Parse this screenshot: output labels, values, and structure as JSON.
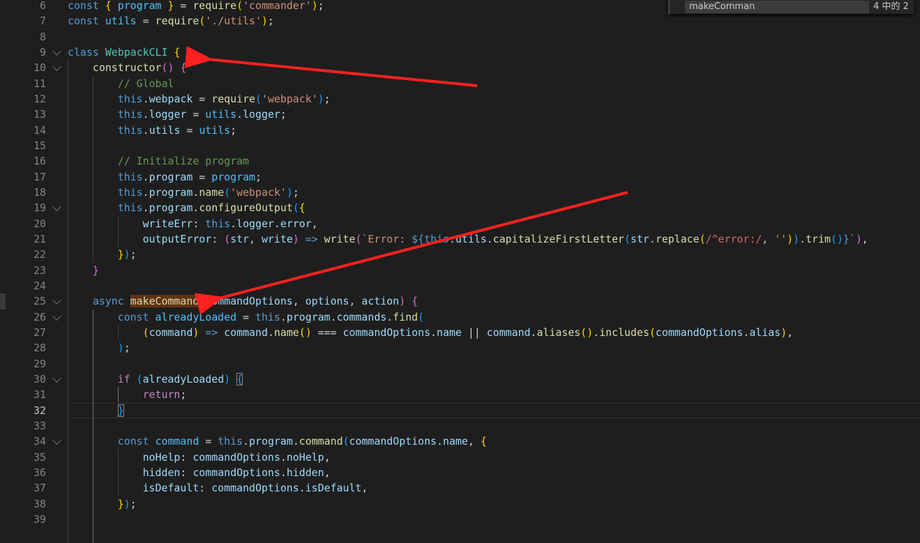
{
  "find_widget": {
    "query": "makeComman",
    "result_count": "4 中的 2"
  },
  "current_line": 32,
  "annotation_color": "#ff2020",
  "lines": [
    {
      "n": 6,
      "t": [
        [
          "k",
          "const "
        ],
        [
          "b1",
          "{"
        ],
        [
          "cv",
          " program "
        ],
        [
          "b1",
          "}"
        ],
        [
          "p",
          " = "
        ],
        [
          "f",
          "require"
        ],
        [
          "b1",
          "("
        ],
        [
          "s",
          "'commander'"
        ],
        [
          "b1",
          ")"
        ],
        [
          "p",
          ";"
        ]
      ]
    },
    {
      "n": 7,
      "t": [
        [
          "k",
          "const "
        ],
        [
          "cv",
          "utils"
        ],
        [
          "p",
          " = "
        ],
        [
          "f",
          "require"
        ],
        [
          "b1",
          "("
        ],
        [
          "s",
          "'./utils'"
        ],
        [
          "b1",
          ")"
        ],
        [
          "p",
          ";"
        ]
      ]
    },
    {
      "n": 8,
      "t": []
    },
    {
      "n": 9,
      "fold": true,
      "t": [
        [
          "k",
          "class "
        ],
        [
          "t",
          "WebpackCLI "
        ],
        [
          "b1",
          "{"
        ]
      ]
    },
    {
      "n": 10,
      "fold": true,
      "t": [
        [
          "p",
          "    "
        ],
        [
          "f",
          "constructor"
        ],
        [
          "b2",
          "()"
        ],
        [
          "p",
          " "
        ],
        [
          "b2",
          "{"
        ]
      ]
    },
    {
      "n": 11,
      "t": [
        [
          "p",
          "        "
        ],
        [
          "cm",
          "// Global"
        ]
      ]
    },
    {
      "n": 12,
      "t": [
        [
          "p",
          "        "
        ],
        [
          "k",
          "this"
        ],
        [
          "p",
          "."
        ],
        [
          "v",
          "webpack"
        ],
        [
          "p",
          " = "
        ],
        [
          "f",
          "require"
        ],
        [
          "b3",
          "("
        ],
        [
          "s",
          "'webpack'"
        ],
        [
          "b3",
          ")"
        ],
        [
          "p",
          ";"
        ]
      ]
    },
    {
      "n": 13,
      "t": [
        [
          "p",
          "        "
        ],
        [
          "k",
          "this"
        ],
        [
          "p",
          "."
        ],
        [
          "v",
          "logger"
        ],
        [
          "p",
          " = "
        ],
        [
          "cv",
          "utils"
        ],
        [
          "p",
          "."
        ],
        [
          "v",
          "logger"
        ],
        [
          "p",
          ";"
        ]
      ]
    },
    {
      "n": 14,
      "t": [
        [
          "p",
          "        "
        ],
        [
          "k",
          "this"
        ],
        [
          "p",
          "."
        ],
        [
          "v",
          "utils"
        ],
        [
          "p",
          " = "
        ],
        [
          "cv",
          "utils"
        ],
        [
          "p",
          ";"
        ]
      ]
    },
    {
      "n": 15,
      "t": []
    },
    {
      "n": 16,
      "t": [
        [
          "p",
          "        "
        ],
        [
          "cm",
          "// Initialize program"
        ]
      ]
    },
    {
      "n": 17,
      "t": [
        [
          "p",
          "        "
        ],
        [
          "k",
          "this"
        ],
        [
          "p",
          "."
        ],
        [
          "v",
          "program"
        ],
        [
          "p",
          " = "
        ],
        [
          "cv",
          "program"
        ],
        [
          "p",
          ";"
        ]
      ]
    },
    {
      "n": 18,
      "t": [
        [
          "p",
          "        "
        ],
        [
          "k",
          "this"
        ],
        [
          "p",
          "."
        ],
        [
          "v",
          "program"
        ],
        [
          "p",
          "."
        ],
        [
          "f",
          "name"
        ],
        [
          "b3",
          "("
        ],
        [
          "s",
          "'webpack'"
        ],
        [
          "b3",
          ")"
        ],
        [
          "p",
          ";"
        ]
      ]
    },
    {
      "n": 19,
      "fold": true,
      "t": [
        [
          "p",
          "        "
        ],
        [
          "k",
          "this"
        ],
        [
          "p",
          "."
        ],
        [
          "v",
          "program"
        ],
        [
          "p",
          "."
        ],
        [
          "f",
          "configureOutput"
        ],
        [
          "b3",
          "("
        ],
        [
          "b1",
          "{"
        ]
      ]
    },
    {
      "n": 20,
      "t": [
        [
          "p",
          "            "
        ],
        [
          "v",
          "writeErr"
        ],
        [
          "p",
          ": "
        ],
        [
          "k",
          "this"
        ],
        [
          "p",
          "."
        ],
        [
          "v",
          "logger"
        ],
        [
          "p",
          "."
        ],
        [
          "v",
          "error"
        ],
        [
          "p",
          ","
        ]
      ]
    },
    {
      "n": 21,
      "t": [
        [
          "p",
          "            "
        ],
        [
          "v",
          "outputError"
        ],
        [
          "p",
          ": "
        ],
        [
          "b2",
          "("
        ],
        [
          "v",
          "str"
        ],
        [
          "p",
          ", "
        ],
        [
          "v",
          "write"
        ],
        [
          "b2",
          ")"
        ],
        [
          "p",
          " "
        ],
        [
          "k",
          "=>"
        ],
        [
          "p",
          " "
        ],
        [
          "f",
          "write"
        ],
        [
          "b2",
          "("
        ],
        [
          "s",
          "`Error: "
        ],
        [
          "k",
          "${"
        ],
        [
          "k",
          "this"
        ],
        [
          "p",
          "."
        ],
        [
          "v",
          "utils"
        ],
        [
          "p",
          "."
        ],
        [
          "f",
          "capitalizeFirstLetter"
        ],
        [
          "b3",
          "("
        ],
        [
          "v",
          "str"
        ],
        [
          "p",
          "."
        ],
        [
          "f",
          "replace"
        ],
        [
          "b1",
          "("
        ],
        [
          "r",
          "/^error:/"
        ],
        [
          "p",
          ", "
        ],
        [
          "s",
          "''"
        ],
        [
          "b1",
          ")"
        ],
        [
          "b3",
          ")"
        ],
        [
          "p",
          "."
        ],
        [
          "f",
          "trim"
        ],
        [
          "b3",
          "()"
        ],
        [
          "k",
          "}"
        ],
        [
          "s",
          "`"
        ],
        [
          "b2",
          ")"
        ],
        [
          "p",
          ","
        ]
      ]
    },
    {
      "n": 22,
      "t": [
        [
          "p",
          "        "
        ],
        [
          "b1",
          "}"
        ],
        [
          "b3",
          ")"
        ],
        [
          "p",
          ";"
        ]
      ]
    },
    {
      "n": 23,
      "t": [
        [
          "p",
          "    "
        ],
        [
          "b2",
          "}"
        ]
      ]
    },
    {
      "n": 24,
      "t": []
    },
    {
      "n": 25,
      "fold": true,
      "t": [
        [
          "p",
          "    "
        ],
        [
          "k",
          "async "
        ],
        [
          "f hl",
          "makeCommand"
        ],
        [
          "b2",
          "("
        ],
        [
          "v",
          "commandOptions"
        ],
        [
          "p",
          ", "
        ],
        [
          "v",
          "options"
        ],
        [
          "p",
          ", "
        ],
        [
          "v",
          "action"
        ],
        [
          "b2",
          ")"
        ],
        [
          "p",
          " "
        ],
        [
          "b2",
          "{"
        ]
      ]
    },
    {
      "n": 26,
      "fold": true,
      "t": [
        [
          "p",
          "        "
        ],
        [
          "k",
          "const "
        ],
        [
          "cv",
          "alreadyLoaded"
        ],
        [
          "p",
          " = "
        ],
        [
          "k",
          "this"
        ],
        [
          "p",
          "."
        ],
        [
          "v",
          "program"
        ],
        [
          "p",
          "."
        ],
        [
          "v",
          "commands"
        ],
        [
          "p",
          "."
        ],
        [
          "f",
          "find"
        ],
        [
          "b3",
          "("
        ]
      ]
    },
    {
      "n": 27,
      "t": [
        [
          "p",
          "            "
        ],
        [
          "b1",
          "("
        ],
        [
          "v",
          "command"
        ],
        [
          "b1",
          ")"
        ],
        [
          "p",
          " "
        ],
        [
          "k",
          "=>"
        ],
        [
          "p",
          " "
        ],
        [
          "v",
          "command"
        ],
        [
          "p",
          "."
        ],
        [
          "f",
          "name"
        ],
        [
          "b1",
          "()"
        ],
        [
          "p",
          " === "
        ],
        [
          "v",
          "commandOptions"
        ],
        [
          "p",
          "."
        ],
        [
          "v",
          "name"
        ],
        [
          "p",
          " || "
        ],
        [
          "v",
          "command"
        ],
        [
          "p",
          "."
        ],
        [
          "f",
          "aliases"
        ],
        [
          "b1",
          "()"
        ],
        [
          "p",
          "."
        ],
        [
          "f",
          "includes"
        ],
        [
          "b1",
          "("
        ],
        [
          "v",
          "commandOptions"
        ],
        [
          "p",
          "."
        ],
        [
          "v",
          "alias"
        ],
        [
          "b1",
          ")"
        ],
        [
          "p",
          ","
        ]
      ]
    },
    {
      "n": 28,
      "t": [
        [
          "p",
          "        "
        ],
        [
          "b3",
          ")"
        ],
        [
          "p",
          ";"
        ]
      ]
    },
    {
      "n": 29,
      "t": []
    },
    {
      "n": 30,
      "fold": true,
      "t": [
        [
          "p",
          "        "
        ],
        [
          "c",
          "if"
        ],
        [
          "p",
          " "
        ],
        [
          "b3",
          "("
        ],
        [
          "v",
          "alreadyLoaded"
        ],
        [
          "b3",
          ")"
        ],
        [
          "p",
          " "
        ],
        [
          "b3 box",
          "{"
        ]
      ]
    },
    {
      "n": 31,
      "t": [
        [
          "p",
          "            "
        ],
        [
          "c",
          "return"
        ],
        [
          "p",
          ";"
        ]
      ]
    },
    {
      "n": 32,
      "t": [
        [
          "p",
          "        "
        ],
        [
          "b3 box",
          "}"
        ]
      ]
    },
    {
      "n": 33,
      "t": []
    },
    {
      "n": 34,
      "fold": true,
      "t": [
        [
          "p",
          "        "
        ],
        [
          "k",
          "const "
        ],
        [
          "cv",
          "command"
        ],
        [
          "p",
          " = "
        ],
        [
          "k",
          "this"
        ],
        [
          "p",
          "."
        ],
        [
          "v",
          "program"
        ],
        [
          "p",
          "."
        ],
        [
          "f",
          "command"
        ],
        [
          "b3",
          "("
        ],
        [
          "v",
          "commandOptions"
        ],
        [
          "p",
          "."
        ],
        [
          "v",
          "name"
        ],
        [
          "p",
          ", "
        ],
        [
          "b1",
          "{"
        ]
      ]
    },
    {
      "n": 35,
      "t": [
        [
          "p",
          "            "
        ],
        [
          "v",
          "noHelp"
        ],
        [
          "p",
          ": "
        ],
        [
          "v",
          "commandOptions"
        ],
        [
          "p",
          "."
        ],
        [
          "v",
          "noHelp"
        ],
        [
          "p",
          ","
        ]
      ]
    },
    {
      "n": 36,
      "t": [
        [
          "p",
          "            "
        ],
        [
          "v",
          "hidden"
        ],
        [
          "p",
          ": "
        ],
        [
          "v",
          "commandOptions"
        ],
        [
          "p",
          "."
        ],
        [
          "v",
          "hidden"
        ],
        [
          "p",
          ","
        ]
      ]
    },
    {
      "n": 37,
      "t": [
        [
          "p",
          "            "
        ],
        [
          "v",
          "isDefault"
        ],
        [
          "p",
          ": "
        ],
        [
          "v",
          "commandOptions"
        ],
        [
          "p",
          "."
        ],
        [
          "v",
          "isDefault"
        ],
        [
          "p",
          ","
        ]
      ]
    },
    {
      "n": 38,
      "t": [
        [
          "p",
          "        "
        ],
        [
          "b1",
          "}"
        ],
        [
          "b3",
          ")"
        ],
        [
          "p",
          ";"
        ]
      ]
    },
    {
      "n": 39,
      "t": []
    }
  ]
}
